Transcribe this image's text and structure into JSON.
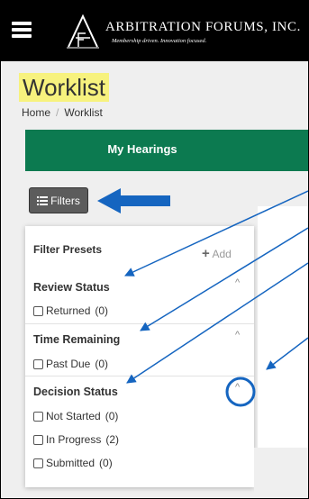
{
  "header": {
    "brand_name": "ARBITRATION FORUMS, INC.",
    "tagline": "Membership driven. Innovation focused."
  },
  "page": {
    "title": "Worklist",
    "breadcrumb": {
      "home": "Home",
      "separator": "/",
      "current": "Worklist"
    }
  },
  "tabs": {
    "my_hearings": "My Hearings"
  },
  "filters_button": {
    "label": "Filters"
  },
  "filter_panel": {
    "presets_label": "Filter Presets",
    "add_label": "Add",
    "sections": [
      {
        "title": "Review Status",
        "options": [
          {
            "label": "Returned",
            "count": "(0)"
          }
        ]
      },
      {
        "title": "Time Remaining",
        "options": [
          {
            "label": "Past Due",
            "count": "(0)"
          }
        ]
      },
      {
        "title": "Decision Status",
        "options": [
          {
            "label": "Not Started",
            "count": "(0)"
          },
          {
            "label": "In Progress",
            "count": "(2)"
          },
          {
            "label": "Submitted",
            "count": "(0)"
          }
        ]
      }
    ]
  },
  "colors": {
    "header_bg": "#000000",
    "tab_green": "#0c7a50",
    "title_highlight": "#f7f27e",
    "annotation_blue": "#1565c0"
  }
}
